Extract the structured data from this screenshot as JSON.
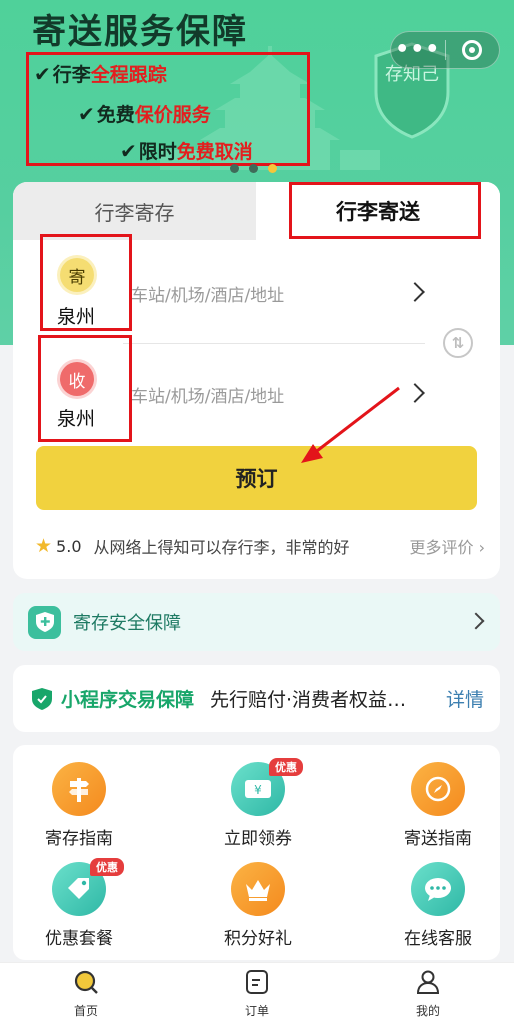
{
  "banner": {
    "title": "寄送服务保障",
    "features": [
      {
        "plain": "行李",
        "highlight": "全程跟踪"
      },
      {
        "plain": "免费",
        "highlight": "保价服务"
      },
      {
        "plain": "限时",
        "highlight": "免费取消"
      }
    ],
    "shield_text": "存知己",
    "slide_count": 3,
    "active_slide": 2
  },
  "capsule": {
    "more_icon": "more-dots-icon",
    "close_icon": "target-icon"
  },
  "tabs": [
    {
      "label": "行李寄存",
      "active": false
    },
    {
      "label": "行李寄送",
      "active": true
    }
  ],
  "form": {
    "sender": {
      "badge": "寄",
      "city": "泉州",
      "placeholder": "车站/机场/酒店/地址"
    },
    "receiver": {
      "badge": "收",
      "city": "泉州",
      "placeholder": "车站/机场/酒店/地址"
    },
    "book_label": "预订"
  },
  "review": {
    "score": "5.0",
    "text": "从网络上得知可以存行李，非常的好",
    "more": "更多评价"
  },
  "safety": {
    "label": "寄存安全保障"
  },
  "guarantee": {
    "title": "小程序交易保障",
    "desc": "先行赔付·消费者权益保障",
    "link": "详情"
  },
  "services": [
    {
      "label": "寄存指南",
      "icon": "signpost-icon",
      "badge": ""
    },
    {
      "label": "立即领券",
      "icon": "coupon-icon",
      "badge": "优惠"
    },
    {
      "label": "寄送指南",
      "icon": "compass-icon",
      "badge": ""
    },
    {
      "label": "优惠套餐",
      "icon": "price-tag-icon",
      "badge": "优惠"
    },
    {
      "label": "积分好礼",
      "icon": "crown-icon",
      "badge": ""
    },
    {
      "label": "在线客服",
      "icon": "chat-icon",
      "badge": ""
    }
  ],
  "tabbar": [
    {
      "label": "首页",
      "icon": "home-search-icon",
      "active": true
    },
    {
      "label": "订单",
      "icon": "order-icon",
      "active": false
    },
    {
      "label": "我的",
      "icon": "user-icon",
      "active": false
    }
  ],
  "colors": {
    "banner_green": "#4fd19a",
    "book_yellow": "#f1d23e",
    "highlight_red": "#e31f1f",
    "annotation_red": "#e3141a",
    "link_blue": "#3c7fb0",
    "trust_green": "#18a66a"
  }
}
